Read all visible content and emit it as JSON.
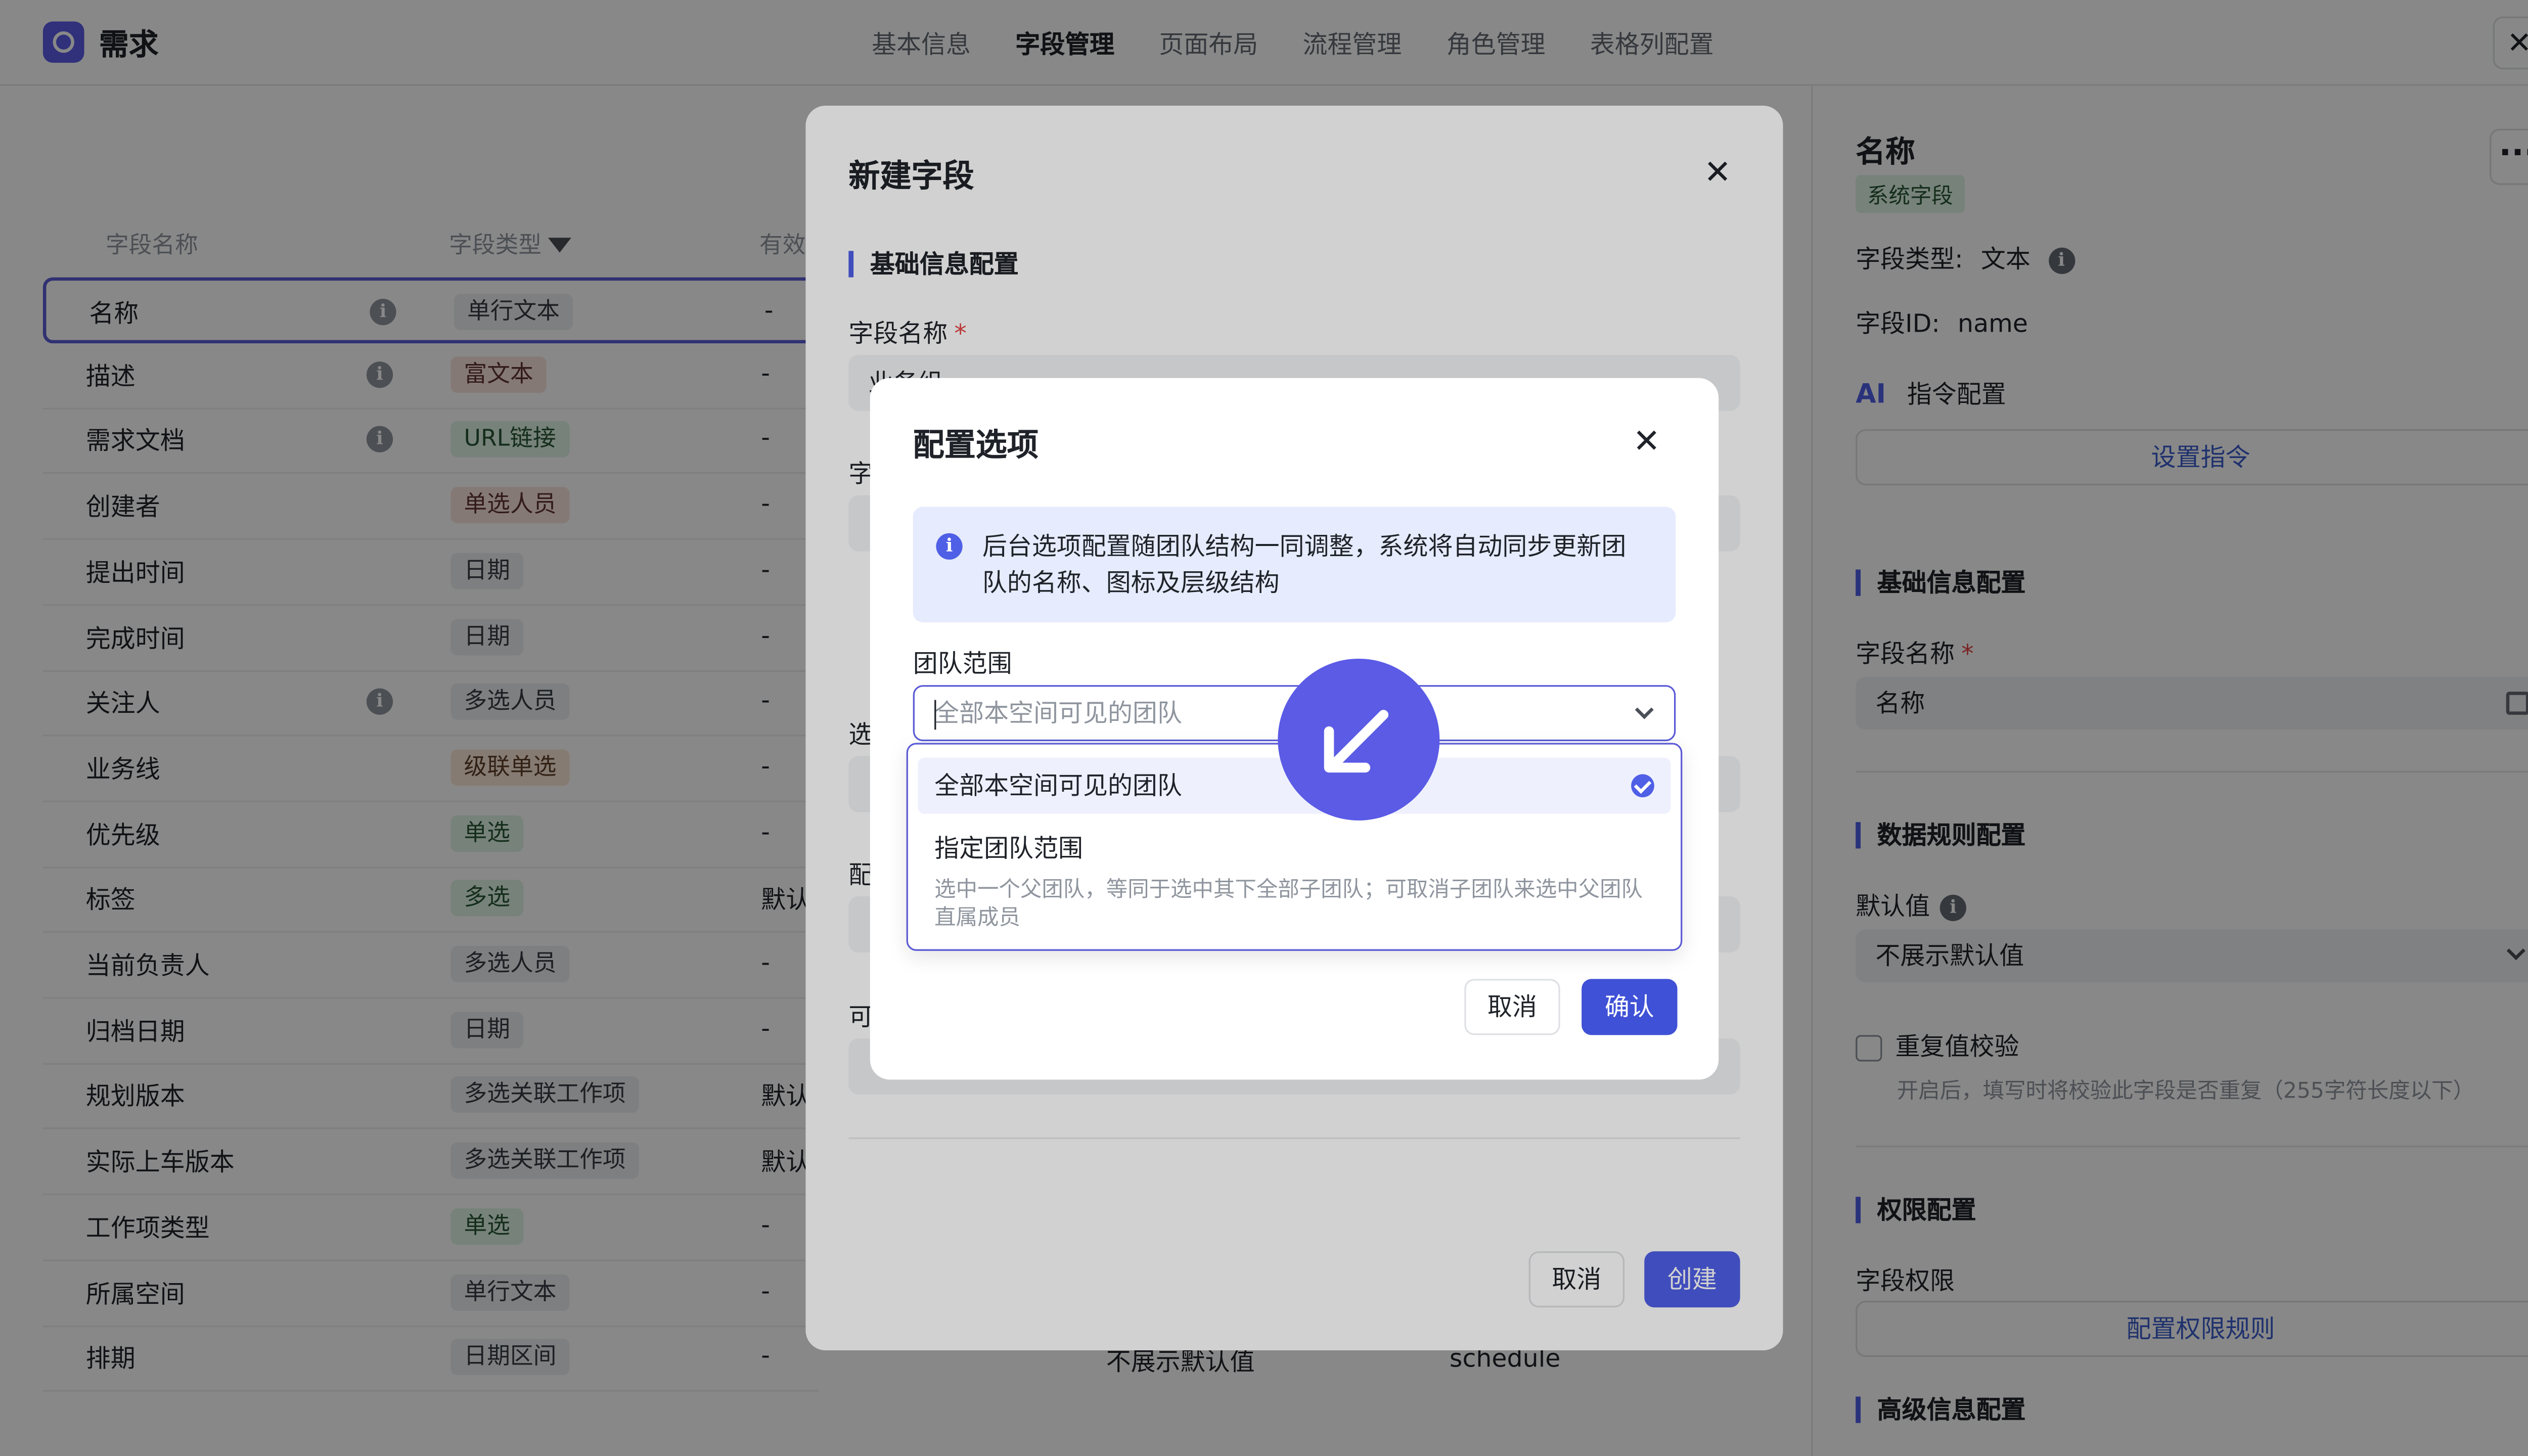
{
  "app": {
    "title": "需求"
  },
  "tabs": [
    {
      "label": "基本信息"
    },
    {
      "label": "字段管理"
    },
    {
      "label": "页面布局"
    },
    {
      "label": "流程管理"
    },
    {
      "label": "角色管理"
    },
    {
      "label": "表格列配置"
    }
  ],
  "active_tab": "字段管理",
  "table": {
    "headers": {
      "name": "字段名称",
      "type": "字段类型",
      "valid": "有效"
    },
    "rows": [
      {
        "name": "名称",
        "type": "单行文本",
        "valid": "-",
        "info": true,
        "tag_color": "grey"
      },
      {
        "name": "描述",
        "type": "富文本",
        "valid": "-",
        "info": true,
        "tag_color": "pink"
      },
      {
        "name": "需求文档",
        "type": "URL链接",
        "valid": "-",
        "info": true,
        "tag_color": "green"
      },
      {
        "name": "创建者",
        "type": "单选人员",
        "valid": "-",
        "info": false,
        "tag_color": "pink"
      },
      {
        "name": "提出时间",
        "type": "日期",
        "valid": "-",
        "info": false,
        "tag_color": "grey"
      },
      {
        "name": "完成时间",
        "type": "日期",
        "valid": "-",
        "info": false,
        "tag_color": "grey"
      },
      {
        "name": "关注人",
        "type": "多选人员",
        "valid": "-",
        "info": true,
        "tag_color": "grey"
      },
      {
        "name": "业务线",
        "type": "级联单选",
        "valid": "-",
        "info": false,
        "tag_color": "orange"
      },
      {
        "name": "优先级",
        "type": "单选",
        "valid": "-",
        "info": false,
        "tag_color": "green"
      },
      {
        "name": "标签",
        "type": "多选",
        "valid": "默认",
        "info": false,
        "tag_color": "green"
      },
      {
        "name": "当前负责人",
        "type": "多选人员",
        "valid": "-",
        "info": false,
        "tag_color": "grey"
      },
      {
        "name": "归档日期",
        "type": "日期",
        "valid": "-",
        "info": false,
        "tag_color": "grey"
      },
      {
        "name": "规划版本",
        "type": "多选关联工作项",
        "valid": "默认",
        "info": false,
        "tag_color": "grey"
      },
      {
        "name": "实际上车版本",
        "type": "多选关联工作项",
        "valid": "默认",
        "info": false,
        "tag_color": "grey"
      },
      {
        "name": "工作项类型",
        "type": "单选",
        "valid": "-",
        "info": false,
        "tag_color": "green"
      },
      {
        "name": "所属空间",
        "type": "单行文本",
        "valid": "-",
        "info": false,
        "tag_color": "grey"
      },
      {
        "name": "排期",
        "type": "日期区间",
        "valid": "-",
        "info": false,
        "tag_color": "grey"
      }
    ],
    "background_cells": {
      "default_text": "不展示默认值",
      "field_id": "schedule"
    }
  },
  "right_panel": {
    "title": "名称",
    "system_badge": "系统字段",
    "field_type_label": "字段类型:",
    "field_type_value": "文本",
    "field_id_label": "字段ID:",
    "field_id_value": "name",
    "ai_badge": "AI",
    "ai_config_label": "指令配置",
    "set_instruction_button": "设置指令",
    "basic_section": "基础信息配置",
    "field_name_label": "字段名称",
    "field_name_value": "名称",
    "data_rule_section": "数据规则配置",
    "default_value_label": "默认值",
    "default_value_option": "不展示默认值",
    "duplicate_check_label": "重复值校验",
    "duplicate_check_hint": "开启后，填写时将校验此字段是否重复（255字符长度以下）",
    "permission_section": "权限配置",
    "field_permission_label": "字段权限",
    "permission_button": "配置权限规则",
    "advanced_section": "高级信息配置"
  },
  "dialog_new_field": {
    "title": "新建字段",
    "basic_section": "基础信息配置",
    "field_name_label": "字段名称",
    "field_name_value": "业务组",
    "partial_labels": [
      "字",
      "选",
      "配",
      "可"
    ],
    "cancel": "取消",
    "create": "创建"
  },
  "dialog_options": {
    "title": "配置选项",
    "notice": "后台选项配置随团队结构一同调整，系统将自动同步更新团队的名称、图标及层级结构",
    "team_scope_label": "团队范围",
    "select_placeholder": "全部本空间可见的团队",
    "options": [
      {
        "label": "全部本空间可见的团队",
        "selected": true
      },
      {
        "label": "指定团队范围",
        "description": "选中一个父团队，等同于选中其下全部子团队；可取消子团队来选中父团队直属成员",
        "selected": false
      }
    ],
    "cancel": "取消",
    "confirm": "确认"
  },
  "colors": {
    "accent": "#4f5fe6",
    "selection_border": "#5b5bd6",
    "tag_grey": "#eceef1",
    "tag_pink": "#fbe3df",
    "tag_green": "#dff5e5",
    "tag_orange": "#fbe9d8"
  },
  "icons": [
    "app-logo-icon",
    "close-icon",
    "filter-icon",
    "info-icon",
    "more-icon",
    "edit-icon",
    "chevron-down-icon",
    "check-circle-icon",
    "help-icon",
    "cursor-arrow-icon"
  ]
}
